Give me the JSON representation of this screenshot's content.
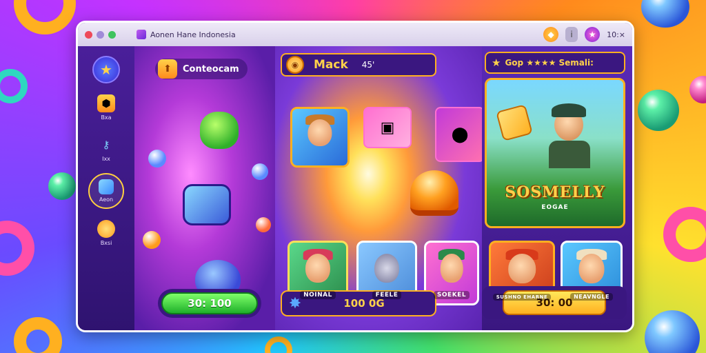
{
  "window": {
    "title": "Aonen Hane Indonesia",
    "close_label": "10:×"
  },
  "sidebar": {
    "items": [
      {
        "label": "Bxa",
        "icon": "shield-icon"
      },
      {
        "label": "Ixx",
        "icon": "key-icon"
      },
      {
        "label": "Aeon",
        "icon": "cube-icon"
      },
      {
        "label": "Bxsi",
        "icon": "coin-icon"
      }
    ]
  },
  "left_panel": {
    "title": "Conteocam",
    "button_label": "30: 100"
  },
  "middle_panel": {
    "title": "Mack",
    "score": "45'",
    "tiles": [
      {
        "label": "NOINAL"
      },
      {
        "label": "FEELE"
      },
      {
        "label": "SOEKEL"
      }
    ],
    "bar_value": "100 0G"
  },
  "right_panel": {
    "title": "Gop ★★★★ Semali:",
    "card_logo": "SOSMELLY",
    "card_sublogo": "EOGAE",
    "tiles": [
      {
        "label": "SUSHNO EHARNE"
      },
      {
        "label": "NEAVNGLE"
      }
    ],
    "button_label": "30: 00"
  },
  "colors": {
    "accent_gold": "#ffb020",
    "panel_purple": "#3a1780",
    "button_green": "#1fb02a",
    "button_yellow": "#ffb020"
  }
}
